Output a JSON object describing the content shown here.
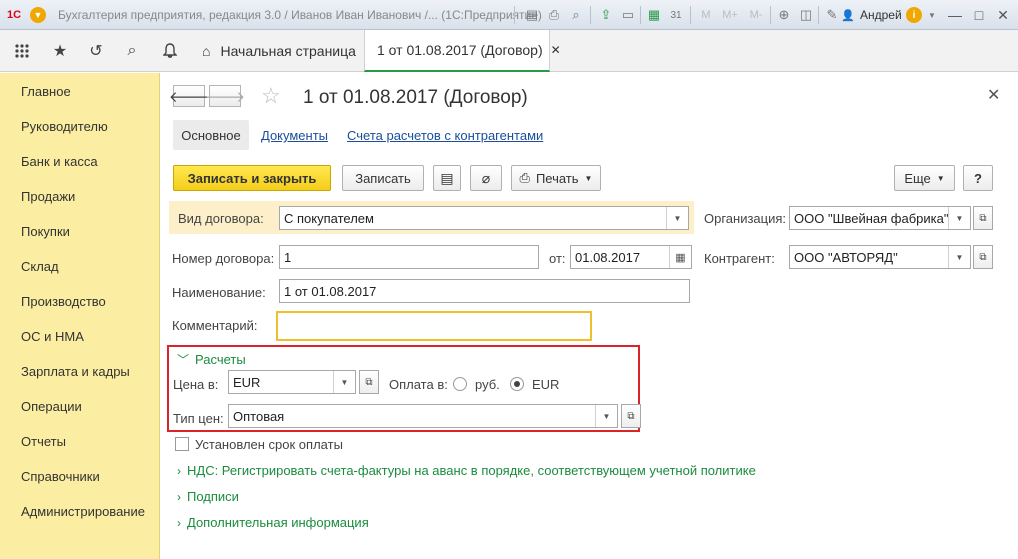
{
  "titlebar": {
    "title": "Бухгалтерия предприятия, редакция 3.0 / Иванов Иван Иванович /...  (1С:Предприятие)",
    "user": "Андрей",
    "icons": [
      "1c-logo-icon",
      "menu-icon",
      "save-icon",
      "print-icon",
      "preview-icon",
      "doc-icon",
      "calc-icon",
      "calendar-icon",
      "zoom-icon",
      "panel-icon",
      "settings-icon",
      "info-icon"
    ],
    "memory": [
      "M",
      "M+",
      "M-"
    ]
  },
  "nav": {
    "tabs": [
      {
        "label": "Начальная страница"
      },
      {
        "label": "1 от 01.08.2017 (Договор)"
      }
    ]
  },
  "sidebar": {
    "items": [
      "Главное",
      "Руководителю",
      "Банк и касса",
      "Продажи",
      "Покупки",
      "Склад",
      "Производство",
      "ОС и НМА",
      "Зарплата и кадры",
      "Операции",
      "Отчеты",
      "Справочники",
      "Администрирование"
    ]
  },
  "doc": {
    "title": "1 от 01.08.2017 (Договор)",
    "subtabs": {
      "main": "Основное",
      "docs": "Документы",
      "accounts": "Счета расчетов с контрагентами"
    }
  },
  "toolbar": {
    "save_close": "Записать и закрыть",
    "save": "Записать",
    "print": "Печать",
    "more": "Еще",
    "help": "?"
  },
  "form": {
    "contract_type_label": "Вид договора:",
    "contract_type": "С покупателем",
    "org_label": "Организация:",
    "org": "ООО \"Швейная фабрика\"",
    "number_label": "Номер договора:",
    "number": "1",
    "date_label": "от:",
    "date": "01.08.2017",
    "counterparty_label": "Контрагент:",
    "counterparty": "ООО \"АВТОРЯД\"",
    "name_label": "Наименование:",
    "name": "1 от 01.08.2017",
    "comment_label": "Комментарий:",
    "comment": ""
  },
  "settlements": {
    "title": "Расчеты",
    "price_label": "Цена в:",
    "price_currency": "EUR",
    "payment_label": "Оплата в:",
    "payment_options": [
      "руб.",
      "EUR"
    ],
    "payment_selected": "EUR",
    "price_type_label": "Тип цен:",
    "price_type": "Оптовая"
  },
  "extra": {
    "payment_term": "Установлен срок оплаты",
    "vat": "НДС: Регистрировать счета-фактуры на аванс в порядке, соответствующем учетной политике",
    "signatures": "Подписи",
    "additional": "Дополнительная информация"
  },
  "colors": {
    "sidebar_bg": "#fbeea2",
    "primary_button": "#f4cd1a",
    "group_border": "#d9252a",
    "green_link": "#1a8c3e",
    "blue_link": "#1a4e9a"
  }
}
